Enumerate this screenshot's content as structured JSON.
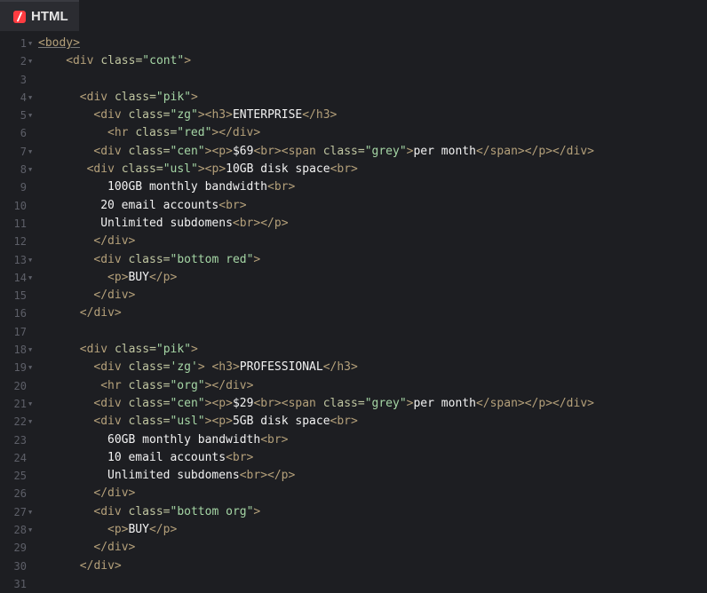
{
  "tab": {
    "label": "HTML"
  },
  "lines": [
    {
      "n": "1",
      "f": true,
      "indent": 0,
      "tokens": [
        {
          "k": "t",
          "v": "<body>",
          "u": true
        }
      ]
    },
    {
      "n": "2",
      "f": true,
      "indent": 4,
      "tokens": [
        {
          "k": "t",
          "v": "<div "
        },
        {
          "k": "a",
          "v": "class="
        },
        {
          "k": "s",
          "v": "\"cont\""
        },
        {
          "k": "t",
          "v": ">"
        }
      ]
    },
    {
      "n": "3",
      "f": false,
      "indent": 0,
      "tokens": []
    },
    {
      "n": "4",
      "f": true,
      "indent": 6,
      "tokens": [
        {
          "k": "t",
          "v": "<div "
        },
        {
          "k": "a",
          "v": "class="
        },
        {
          "k": "s",
          "v": "\"pik\""
        },
        {
          "k": "t",
          "v": ">"
        }
      ]
    },
    {
      "n": "5",
      "f": true,
      "indent": 8,
      "tokens": [
        {
          "k": "t",
          "v": "<div "
        },
        {
          "k": "a",
          "v": "class="
        },
        {
          "k": "s",
          "v": "\"zg\""
        },
        {
          "k": "t",
          "v": "><h3>"
        },
        {
          "k": "x",
          "v": "ENTERPRISE"
        },
        {
          "k": "t",
          "v": "</h3>"
        }
      ]
    },
    {
      "n": "6",
      "f": false,
      "indent": 10,
      "tokens": [
        {
          "k": "t",
          "v": "<hr "
        },
        {
          "k": "a",
          "v": "class="
        },
        {
          "k": "s",
          "v": "\"red\""
        },
        {
          "k": "t",
          "v": "></div>"
        }
      ]
    },
    {
      "n": "7",
      "f": true,
      "indent": 8,
      "tokens": [
        {
          "k": "t",
          "v": "<div "
        },
        {
          "k": "a",
          "v": "class="
        },
        {
          "k": "s",
          "v": "\"cen\""
        },
        {
          "k": "t",
          "v": "><p>"
        },
        {
          "k": "x",
          "v": "$69"
        },
        {
          "k": "t",
          "v": "<br><span "
        },
        {
          "k": "a",
          "v": "class="
        },
        {
          "k": "s",
          "v": "\"grey\""
        },
        {
          "k": "t",
          "v": ">"
        },
        {
          "k": "x",
          "v": "per month"
        },
        {
          "k": "t",
          "v": "</span></p></div>"
        }
      ]
    },
    {
      "n": "8",
      "f": true,
      "indent": 7,
      "tokens": [
        {
          "k": "t",
          "v": "<div "
        },
        {
          "k": "a",
          "v": "class="
        },
        {
          "k": "s",
          "v": "\"usl\""
        },
        {
          "k": "t",
          "v": "><p>"
        },
        {
          "k": "x",
          "v": "10GB disk space"
        },
        {
          "k": "t",
          "v": "<br>"
        }
      ]
    },
    {
      "n": "9",
      "f": false,
      "indent": 10,
      "tokens": [
        {
          "k": "x",
          "v": "100GB monthly bandwidth"
        },
        {
          "k": "t",
          "v": "<br>"
        }
      ]
    },
    {
      "n": "10",
      "f": false,
      "indent": 9,
      "tokens": [
        {
          "k": "x",
          "v": "20 email accounts"
        },
        {
          "k": "t",
          "v": "<br>"
        }
      ]
    },
    {
      "n": "11",
      "f": false,
      "indent": 9,
      "tokens": [
        {
          "k": "x",
          "v": "Unlimited subdomens"
        },
        {
          "k": "t",
          "v": "<br></p>"
        }
      ]
    },
    {
      "n": "12",
      "f": false,
      "indent": 8,
      "tokens": [
        {
          "k": "t",
          "v": "</div>"
        }
      ]
    },
    {
      "n": "13",
      "f": true,
      "indent": 8,
      "tokens": [
        {
          "k": "t",
          "v": "<div "
        },
        {
          "k": "a",
          "v": "class="
        },
        {
          "k": "s",
          "v": "\"bottom red\""
        },
        {
          "k": "t",
          "v": ">"
        }
      ]
    },
    {
      "n": "14",
      "f": true,
      "indent": 10,
      "tokens": [
        {
          "k": "t",
          "v": "<p>"
        },
        {
          "k": "x",
          "v": "BUY"
        },
        {
          "k": "t",
          "v": "</p>"
        }
      ]
    },
    {
      "n": "15",
      "f": false,
      "indent": 8,
      "tokens": [
        {
          "k": "t",
          "v": "</div>"
        }
      ]
    },
    {
      "n": "16",
      "f": false,
      "indent": 6,
      "tokens": [
        {
          "k": "t",
          "v": "</div>"
        }
      ]
    },
    {
      "n": "17",
      "f": false,
      "indent": 0,
      "tokens": []
    },
    {
      "n": "18",
      "f": true,
      "indent": 6,
      "tokens": [
        {
          "k": "t",
          "v": "<div "
        },
        {
          "k": "a",
          "v": "class="
        },
        {
          "k": "s",
          "v": "\"pik\""
        },
        {
          "k": "t",
          "v": ">"
        }
      ]
    },
    {
      "n": "19",
      "f": true,
      "indent": 8,
      "tokens": [
        {
          "k": "t",
          "v": "<div "
        },
        {
          "k": "a",
          "v": "class="
        },
        {
          "k": "s",
          "v": "'zg'"
        },
        {
          "k": "t",
          "v": "> <h3>"
        },
        {
          "k": "x",
          "v": "PROFESSIONAL"
        },
        {
          "k": "t",
          "v": "</h3>"
        }
      ]
    },
    {
      "n": "20",
      "f": false,
      "indent": 9,
      "tokens": [
        {
          "k": "t",
          "v": "<hr "
        },
        {
          "k": "a",
          "v": "class="
        },
        {
          "k": "s",
          "v": "\"org\""
        },
        {
          "k": "t",
          "v": "></div>"
        }
      ]
    },
    {
      "n": "21",
      "f": true,
      "indent": 8,
      "tokens": [
        {
          "k": "t",
          "v": "<div "
        },
        {
          "k": "a",
          "v": "class="
        },
        {
          "k": "s",
          "v": "\"cen\""
        },
        {
          "k": "t",
          "v": "><p>"
        },
        {
          "k": "x",
          "v": "$29"
        },
        {
          "k": "t",
          "v": "<br><span "
        },
        {
          "k": "a",
          "v": "class="
        },
        {
          "k": "s",
          "v": "\"grey\""
        },
        {
          "k": "t",
          "v": ">"
        },
        {
          "k": "x",
          "v": "per month"
        },
        {
          "k": "t",
          "v": "</span></p></div>"
        }
      ]
    },
    {
      "n": "22",
      "f": true,
      "indent": 8,
      "tokens": [
        {
          "k": "t",
          "v": "<div "
        },
        {
          "k": "a",
          "v": "class="
        },
        {
          "k": "s",
          "v": "\"usl\""
        },
        {
          "k": "t",
          "v": "><p>"
        },
        {
          "k": "x",
          "v": "5GB disk space"
        },
        {
          "k": "t",
          "v": "<br>"
        }
      ]
    },
    {
      "n": "23",
      "f": false,
      "indent": 10,
      "tokens": [
        {
          "k": "x",
          "v": "60GB monthly bandwidth"
        },
        {
          "k": "t",
          "v": "<br>"
        }
      ]
    },
    {
      "n": "24",
      "f": false,
      "indent": 10,
      "tokens": [
        {
          "k": "x",
          "v": "10 email accounts"
        },
        {
          "k": "t",
          "v": "<br>"
        }
      ]
    },
    {
      "n": "25",
      "f": false,
      "indent": 10,
      "tokens": [
        {
          "k": "x",
          "v": "Unlimited subdomens"
        },
        {
          "k": "t",
          "v": "<br></p>"
        }
      ]
    },
    {
      "n": "26",
      "f": false,
      "indent": 8,
      "tokens": [
        {
          "k": "t",
          "v": "</div>"
        }
      ]
    },
    {
      "n": "27",
      "f": true,
      "indent": 8,
      "tokens": [
        {
          "k": "t",
          "v": "<div "
        },
        {
          "k": "a",
          "v": "class="
        },
        {
          "k": "s",
          "v": "\"bottom org\""
        },
        {
          "k": "t",
          "v": ">"
        }
      ]
    },
    {
      "n": "28",
      "f": true,
      "indent": 10,
      "tokens": [
        {
          "k": "t",
          "v": "<p>"
        },
        {
          "k": "x",
          "v": "BUY"
        },
        {
          "k": "t",
          "v": "</p>"
        }
      ]
    },
    {
      "n": "29",
      "f": false,
      "indent": 8,
      "tokens": [
        {
          "k": "t",
          "v": "</div>"
        }
      ]
    },
    {
      "n": "30",
      "f": false,
      "indent": 6,
      "tokens": [
        {
          "k": "t",
          "v": "</div>"
        }
      ]
    },
    {
      "n": "31",
      "f": false,
      "indent": 0,
      "tokens": []
    }
  ]
}
